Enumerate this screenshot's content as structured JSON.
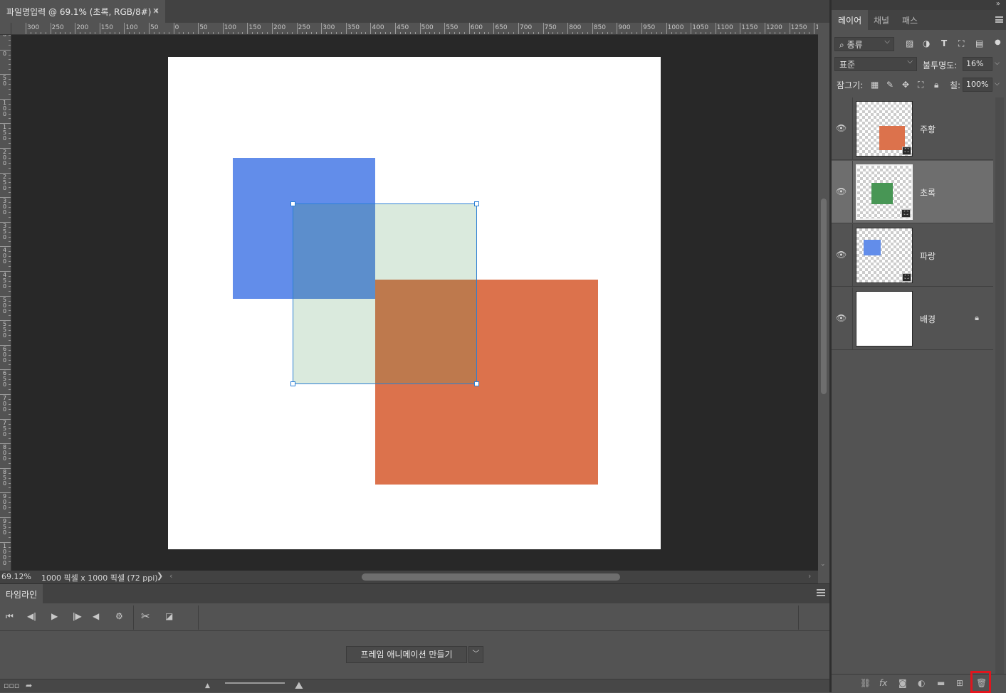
{
  "document": {
    "tab_title": "파일명입력 @ 69.1% (초록, RGB/8#) *",
    "close_glyph": "×"
  },
  "rulers": {
    "horizontal_labels": [
      "300",
      "250",
      "200",
      "150",
      "100",
      "50",
      "0",
      "50",
      "100",
      "150",
      "200",
      "250",
      "300",
      "350",
      "400",
      "450",
      "500",
      "550",
      "600",
      "650",
      "700",
      "750",
      "800",
      "850",
      "900",
      "950",
      "1000",
      "1050",
      "1100",
      "1150",
      "1200",
      "1250",
      "130"
    ],
    "vertical_labels": [
      "50",
      "0",
      "50",
      "100",
      "150",
      "200",
      "250",
      "300",
      "350",
      "400",
      "450",
      "500",
      "550",
      "600",
      "650",
      "700",
      "750",
      "800",
      "850",
      "900",
      "950",
      "1000"
    ]
  },
  "canvas": {
    "background_color": "#ffffff",
    "shapes": [
      {
        "name": "파랑",
        "color": "#628dea"
      },
      {
        "name": "주황",
        "color": "#dc724c"
      },
      {
        "name": "초록",
        "color": "#489655",
        "opacity": 0.16
      }
    ]
  },
  "status": {
    "zoom": "69.12%",
    "doc_size": "1000 픽셀 x 1000 픽셀 (72 ppi)",
    "arrow": "❯"
  },
  "timeline": {
    "tab_label": "타임라인",
    "create_frame_animation": "프레임 애니메이션 만들기"
  },
  "layers_panel": {
    "tabs": [
      "레이어",
      "채널",
      "패스"
    ],
    "active_tab": "레이어",
    "filter_kind": "종류",
    "blend_mode": "표준",
    "opacity_label": "불투명도:",
    "opacity_value": "16%",
    "lock_label": "잠그기:",
    "fill_label": "칠:",
    "fill_value": "100%",
    "layers": [
      {
        "name": "주황",
        "visible": true,
        "selected": false,
        "thumb_color": "#dc724c",
        "smart_object": true,
        "locked": false
      },
      {
        "name": "초록",
        "visible": true,
        "selected": true,
        "thumb_color": "#489655",
        "smart_object": true,
        "locked": false
      },
      {
        "name": "파랑",
        "visible": true,
        "selected": false,
        "thumb_color": "#628dea",
        "smart_object": true,
        "locked": false
      },
      {
        "name": "배경",
        "visible": true,
        "selected": false,
        "thumb_color": "#ffffff",
        "smart_object": false,
        "locked": true
      }
    ]
  },
  "icons": {
    "eye": "eye-icon",
    "smart_object": "smart-object-icon",
    "lock": "lock-icon",
    "delete_layer": "trash-icon"
  },
  "colors": {
    "delete_highlight": "#e0161e",
    "selection": "#2b7fd5"
  }
}
